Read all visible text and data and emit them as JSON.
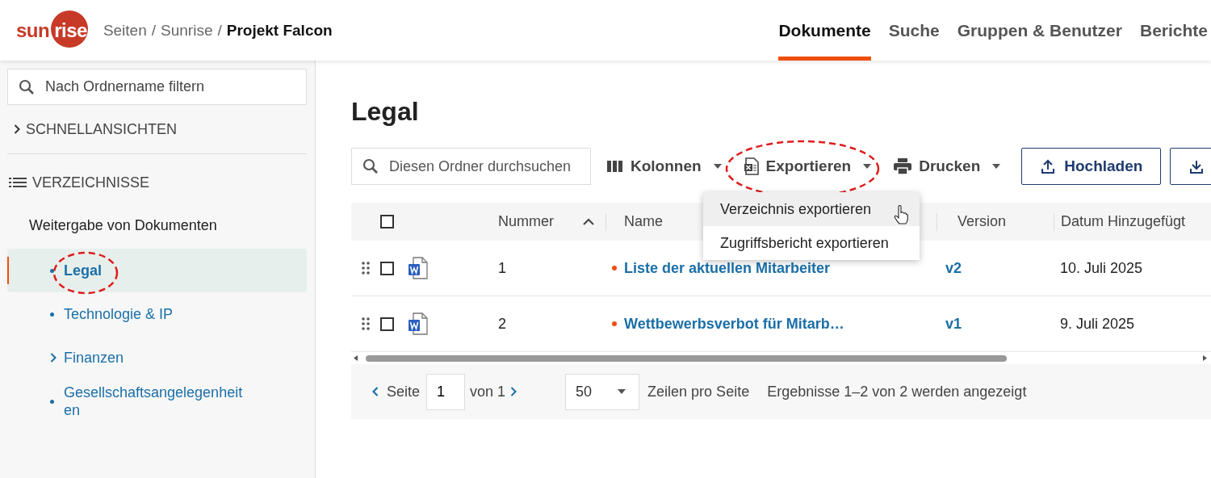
{
  "logo": {
    "prefix": "sun",
    "circled": "rise"
  },
  "breadcrumb": {
    "separator": "/",
    "items": [
      {
        "label": "Seiten",
        "current": false
      },
      {
        "label": "Sunrise",
        "current": false
      },
      {
        "label": "Projekt Falcon",
        "current": true
      }
    ]
  },
  "nav_tabs": [
    {
      "label": "Dokumente",
      "selected": true
    },
    {
      "label": "Suche",
      "selected": false
    },
    {
      "label": "Gruppen & Benutzer",
      "selected": false
    },
    {
      "label": "Berichte",
      "selected": false
    }
  ],
  "sidebar": {
    "filter": {
      "placeholder": "Nach Ordnername filtern"
    },
    "quick_views": {
      "label": "SCHNELLANSICHTEN",
      "expanded": false
    },
    "directories": {
      "label": "VERZEICHNISSE"
    },
    "tree": {
      "label": "Weitergabe von Dokumenten",
      "children": [
        {
          "label": "Legal",
          "kind": "leaf",
          "selected": true,
          "circled": true
        },
        {
          "label": "Technologie & IP",
          "kind": "leaf",
          "selected": false,
          "circled": false
        },
        {
          "label": "Finanzen",
          "kind": "folder",
          "expanded": false,
          "selected": false,
          "circled": false
        },
        {
          "label": "Gesellschaftsangelegenheiten",
          "kind": "leaf",
          "selected": false,
          "circled": false
        }
      ]
    }
  },
  "page_title": "Legal",
  "toolbar": {
    "search": {
      "placeholder": "Diesen Ordner durchsuchen"
    },
    "menus": [
      {
        "label": "Kolonnen",
        "circled": false
      },
      {
        "label": "Exportieren",
        "circled": true
      },
      {
        "label": "Drucken",
        "circled": false
      }
    ],
    "buttons": [
      {
        "label": "Hochladen"
      }
    ]
  },
  "export_menu": {
    "open": true,
    "items": [
      {
        "label": "Verzeichnis exportieren",
        "selected": true
      },
      {
        "label": "Zugriffsbericht exportieren",
        "selected": false
      }
    ]
  },
  "table": {
    "select_all": {
      "checked": false
    },
    "columns": [
      {
        "label": "Nummer",
        "sorted": true
      },
      {
        "label": "Name",
        "sorted": false
      },
      {
        "label": "Version",
        "sorted": false
      },
      {
        "label": "Datum Hinzugefügt",
        "sorted": false
      }
    ],
    "rows": [
      {
        "checked": false,
        "number": "1",
        "name": "Liste der aktuellen Mitarbeiter",
        "new": true,
        "version": "v2",
        "date": "10. Juli 2025"
      },
      {
        "checked": false,
        "number": "2",
        "name": "Wettbewerbsverbot für Mitarb…",
        "new": true,
        "version": "v1",
        "date": "9. Juli 2025"
      }
    ]
  },
  "pagination": {
    "page_label": "Seite",
    "page": "1",
    "of_label": "von 1",
    "page_size": "50",
    "page_size_label": "Zeilen pro Seite",
    "results": "Ergebnisse 1–2 von 2 werden angezeigt"
  }
}
